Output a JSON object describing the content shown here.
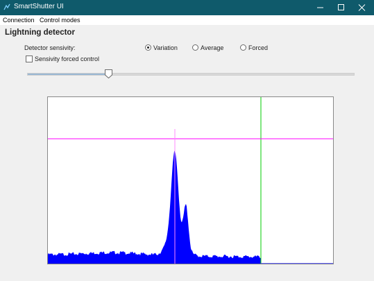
{
  "window": {
    "title": "SmartShutter UI",
    "titlebar_color": "#0f5a6b"
  },
  "menu": {
    "items": [
      "Connection",
      "Control modes"
    ]
  },
  "section": {
    "title": "Lightning detector"
  },
  "detector": {
    "label": "Detector sensivity:",
    "options": [
      {
        "label": "Variation",
        "selected": true
      },
      {
        "label": "Average",
        "selected": false
      },
      {
        "label": "Forced",
        "selected": false
      }
    ],
    "forced_control_label": "Sensivity forced control",
    "forced_control_checked": false,
    "slider_level": 0.25
  },
  "histogram": {
    "fill_color": "#0000ff",
    "threshold_line_color": "#ff00ff",
    "marker_color": "#ff88ff",
    "cutoff_line_color": "#00cc00"
  }
}
